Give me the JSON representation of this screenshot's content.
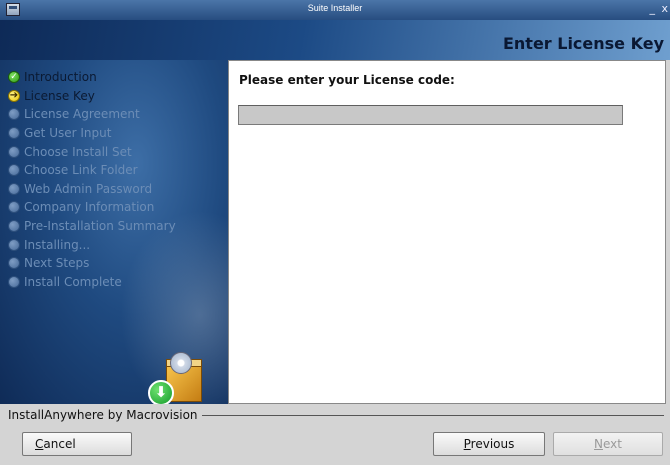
{
  "window": {
    "title": "Suite Installer",
    "minimize_glyph": "_",
    "close_glyph": "x"
  },
  "header": {
    "step_title": "Enter License Key"
  },
  "sidebar": {
    "steps": [
      {
        "label": "Introduction",
        "state": "done",
        "glyph": "✓"
      },
      {
        "label": "License Key",
        "state": "current",
        "glyph": "➔"
      },
      {
        "label": "License Agreement",
        "state": "pending",
        "glyph": ""
      },
      {
        "label": "Get User Input",
        "state": "pending",
        "glyph": ""
      },
      {
        "label": "Choose Install Set",
        "state": "pending",
        "glyph": ""
      },
      {
        "label": "Choose Link Folder",
        "state": "pending",
        "glyph": ""
      },
      {
        "label": "Web Admin Password",
        "state": "pending",
        "glyph": ""
      },
      {
        "label": "Company Information",
        "state": "pending",
        "glyph": ""
      },
      {
        "label": "Pre-Installation Summary",
        "state": "pending",
        "glyph": ""
      },
      {
        "label": "Installing...",
        "state": "pending",
        "glyph": ""
      },
      {
        "label": "Next Steps",
        "state": "pending",
        "glyph": ""
      },
      {
        "label": "Install Complete",
        "state": "pending",
        "glyph": ""
      }
    ]
  },
  "content": {
    "prompt": "Please enter your License code:",
    "license_input": {
      "value": "",
      "placeholder": ""
    }
  },
  "footer": {
    "vendor_label": "InstallAnywhere by Macrovision",
    "cancel": {
      "mnemonic": "C",
      "rest": "ancel"
    },
    "previous": {
      "mnemonic": "P",
      "rest": "revious"
    },
    "next": {
      "mnemonic": "N",
      "rest": "ext",
      "enabled": false
    }
  },
  "colors": {
    "header_dark": "#0e2a57",
    "header_light": "#6f9fcf",
    "sidebar": "#1f4a80",
    "step_done": "#2e9a14",
    "step_current": "#e8c400",
    "step_pending_text": "#6c8db6"
  }
}
